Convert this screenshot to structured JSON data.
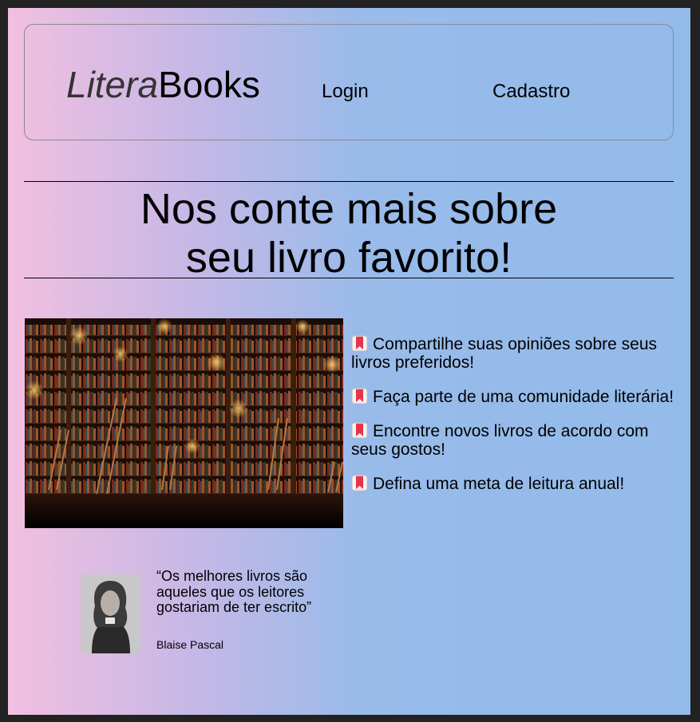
{
  "header": {
    "logo_light": "Litera",
    "logo_bold": "Books",
    "nav": {
      "login": "Login",
      "cadastro": "Cadastro"
    }
  },
  "hero": {
    "title_line1": "Nos conte mais sobre",
    "title_line2": "seu livro favorito!"
  },
  "benefits": [
    {
      "icon": "bookmark-icon",
      "text": "Compartilhe suas opiniões sobre seus livros preferidos!"
    },
    {
      "icon": "bookmark-icon",
      "text": "Faça parte de uma comunidade literária!"
    },
    {
      "icon": "bookmark-icon",
      "text": "Encontre novos livros de acordo com seus gostos!"
    },
    {
      "icon": "bookmark-icon",
      "text": "Defina uma meta de leitura anual!"
    }
  ],
  "quote": {
    "text": "“Os melhores livros são aqueles que os leitores gostariam de ter escrito”",
    "author": "Blaise Pascal"
  },
  "colors": {
    "gradient_left": "#f2bfe0",
    "gradient_right": "#93bbea",
    "bookmark_red": "#e8334a"
  }
}
